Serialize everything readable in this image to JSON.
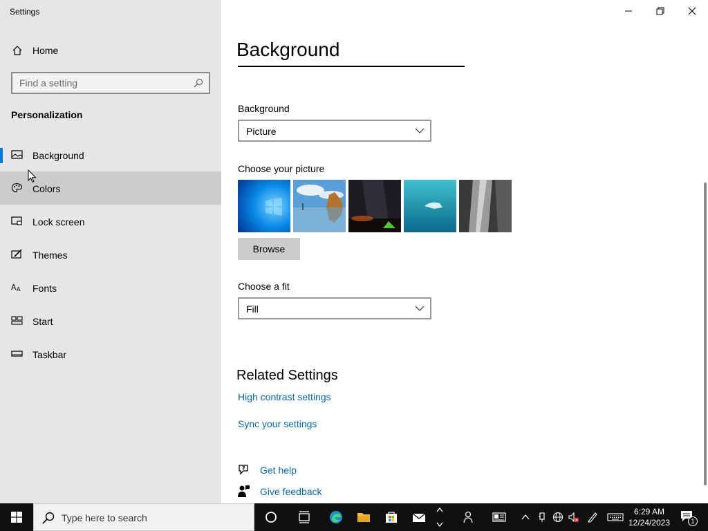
{
  "window": {
    "title": "Settings"
  },
  "sidebar": {
    "home_label": "Home",
    "search_placeholder": "Find a setting",
    "section_title": "Personalization",
    "items": [
      {
        "label": "Background",
        "icon": "picture-icon"
      },
      {
        "label": "Colors",
        "icon": "palette-icon"
      },
      {
        "label": "Lock screen",
        "icon": "lock-screen-icon"
      },
      {
        "label": "Themes",
        "icon": "themes-icon"
      },
      {
        "label": "Fonts",
        "icon": "fonts-icon"
      },
      {
        "label": "Start",
        "icon": "start-icon"
      },
      {
        "label": "Taskbar",
        "icon": "taskbar-icon"
      }
    ]
  },
  "main": {
    "page_title": "Background",
    "background_label": "Background",
    "background_value": "Picture",
    "choose_picture_label": "Choose your picture",
    "browse_label": "Browse",
    "choose_fit_label": "Choose a fit",
    "fit_value": "Fill",
    "related_title": "Related Settings",
    "related_links": [
      "High contrast settings",
      "Sync your settings"
    ],
    "get_help": "Get help",
    "give_feedback": "Give feedback"
  },
  "taskbar": {
    "search_placeholder": "Type here to search",
    "time": "6:29 AM",
    "date": "12/24/2023",
    "notification_count": "1"
  },
  "colors": {
    "accent": "#0078d7",
    "link": "#0067b8",
    "sidebar_bg": "#e6e6e6",
    "taskbar_bg": "#101010"
  }
}
